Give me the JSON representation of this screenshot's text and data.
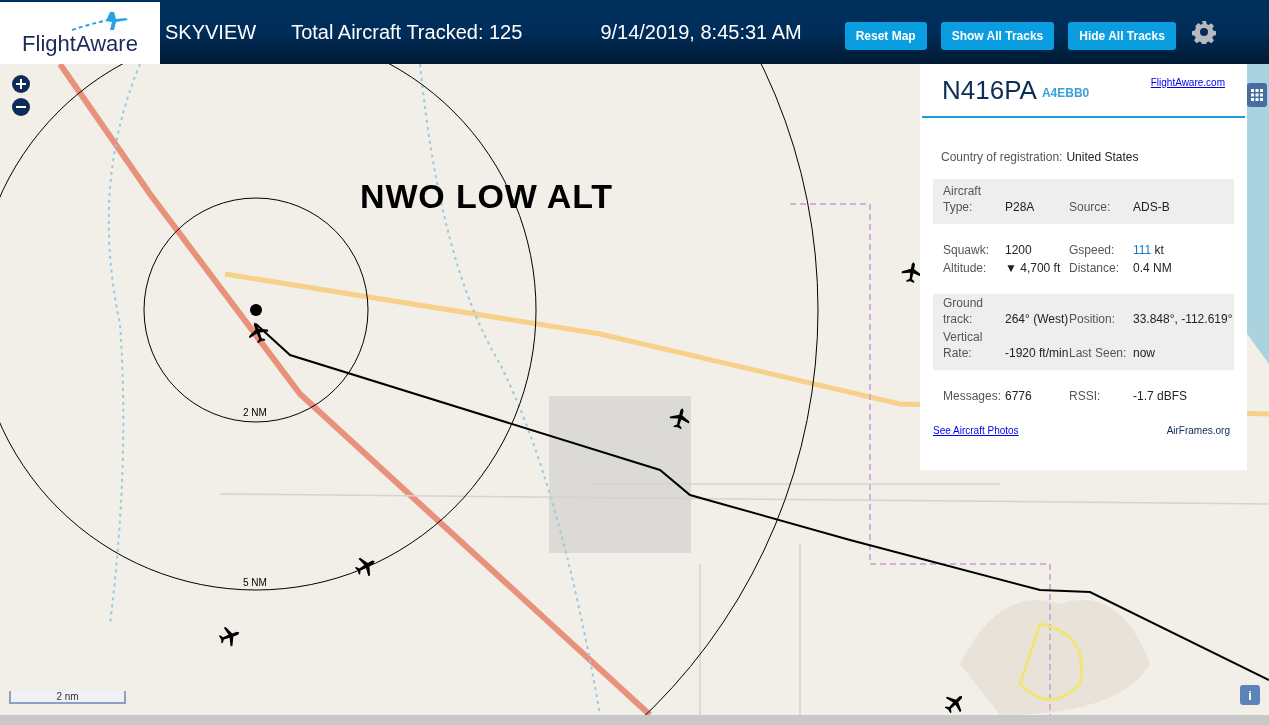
{
  "header": {
    "logo": "FlightAware",
    "title": "SKYVIEW",
    "total": "Total Aircraft Tracked: 125",
    "datetime": "9/14/2019, 8:45:31 AM",
    "buttons": [
      "Reset Map",
      "Show All Tracks",
      "Hide All Tracks"
    ]
  },
  "map": {
    "overlay_title": "NWO LOW ALT",
    "ring_labels": [
      "2 NM",
      "5 NM"
    ],
    "scale": "2 nm",
    "info_button": "i"
  },
  "panel": {
    "callsign": "N416PA",
    "hex": "A4EBB0",
    "link": "FlightAware.com",
    "country_label": "Country of registration:",
    "country": "United States",
    "sections": [
      {
        "shaded": true,
        "rows": [
          [
            {
              "label": "Aircraft Type:",
              "value": "P28A"
            },
            {
              "label": "Source:",
              "value": "ADS-B"
            }
          ]
        ]
      },
      {
        "shaded": false,
        "rows": [
          [
            {
              "label": "Squawk:",
              "value": "1200"
            },
            {
              "label": "Gspeed:",
              "value": "111",
              "unit": "kt",
              "highlight": true
            }
          ],
          [
            {
              "label": "Altitude:",
              "value": "▼ 4,700 ft"
            },
            {
              "label": "Distance:",
              "value": "0.4 NM"
            }
          ]
        ]
      },
      {
        "shaded": true,
        "rows": [
          [
            {
              "label": "Ground track:",
              "value": "264° (West)"
            },
            {
              "label": "Position:",
              "value": "33.848°, -112.619°"
            }
          ],
          [
            {
              "label": "Vertical Rate:",
              "value": "-1920 ft/min"
            },
            {
              "label": "Last Seen:",
              "value": "now"
            }
          ]
        ]
      },
      {
        "shaded": false,
        "rows": [
          [
            {
              "label": "Messages:",
              "value": "6776"
            },
            {
              "label": "RSSI:",
              "value": "-1.7 dBFS"
            }
          ]
        ]
      }
    ],
    "footer_links": [
      "See Aircraft Photos",
      "AirFrames.org"
    ]
  }
}
